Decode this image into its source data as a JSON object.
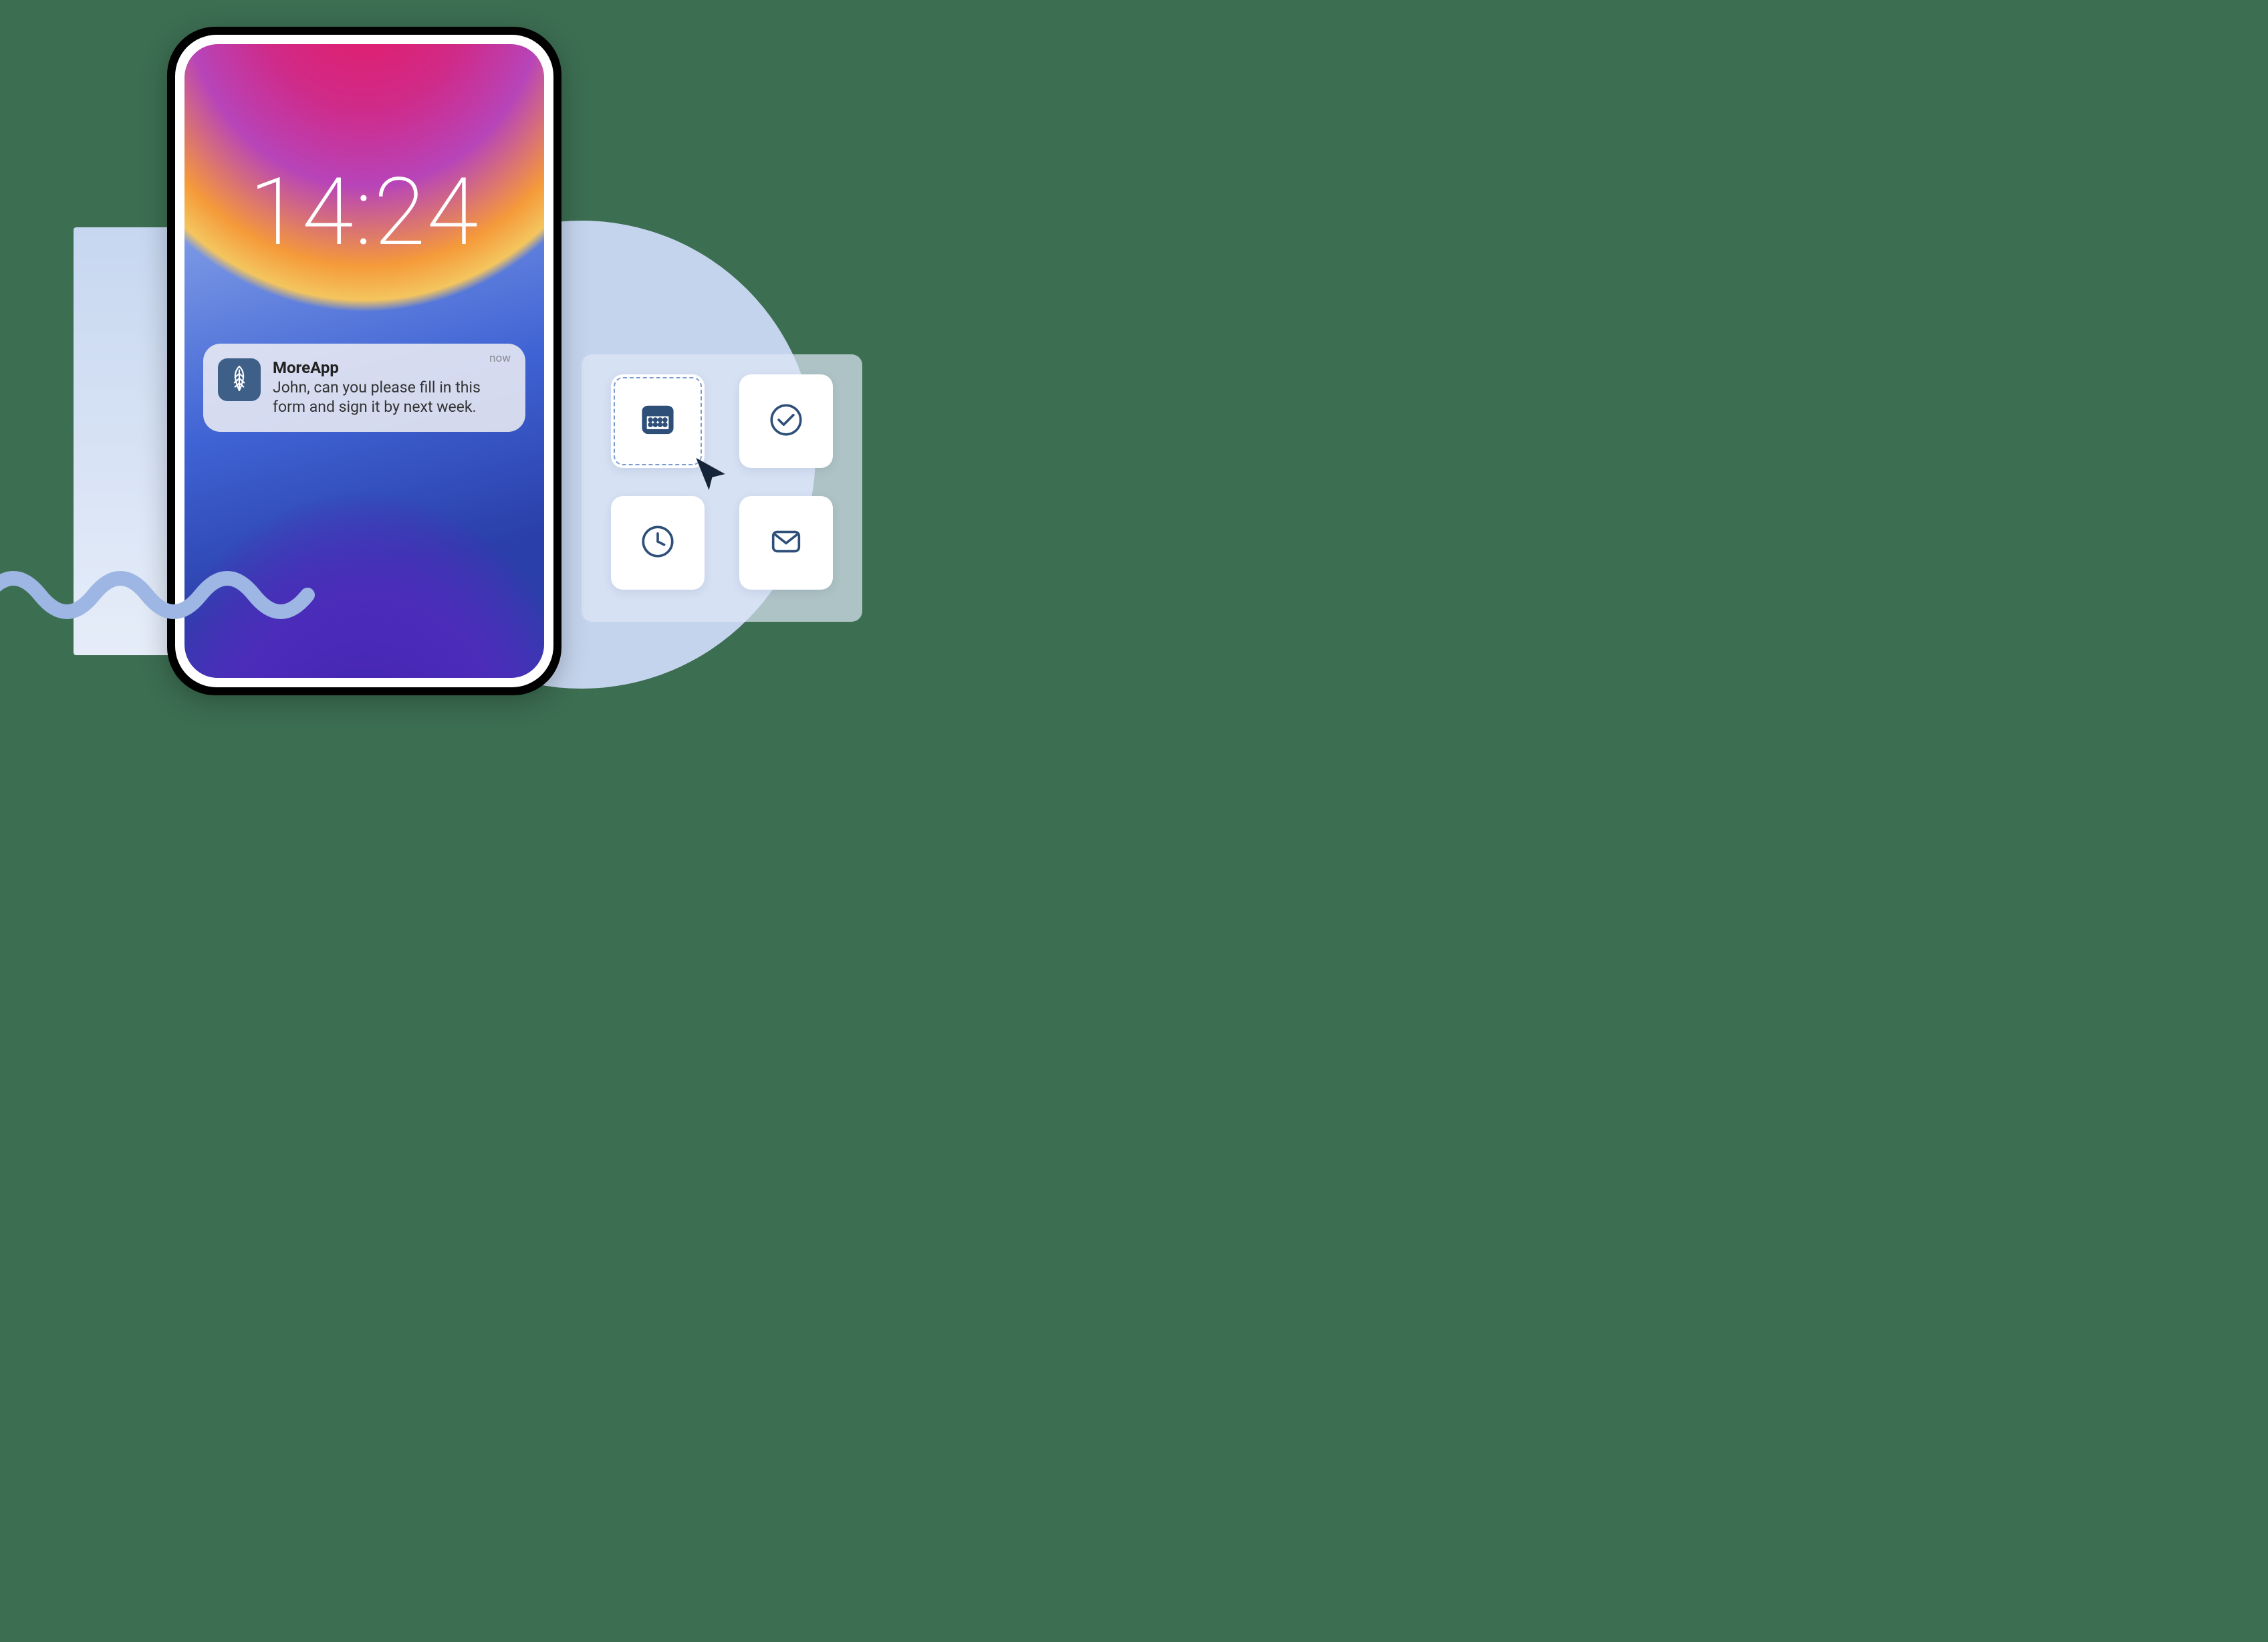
{
  "lockscreen": {
    "time": "14:24"
  },
  "notification": {
    "app_name": "MoreApp",
    "message": "John, can you please fill in this form and sign it by next week.",
    "timestamp_label": "now"
  },
  "icon_panel": {
    "tiles": [
      {
        "name": "calendar-icon",
        "selected": true
      },
      {
        "name": "check-circle-icon",
        "selected": false
      },
      {
        "name": "clock-icon",
        "selected": false
      },
      {
        "name": "mail-icon",
        "selected": false
      }
    ]
  },
  "colors": {
    "brand_navy": "#2e4f78",
    "panel_blue": "#c5d4ed",
    "background_green": "#3c6e52"
  }
}
